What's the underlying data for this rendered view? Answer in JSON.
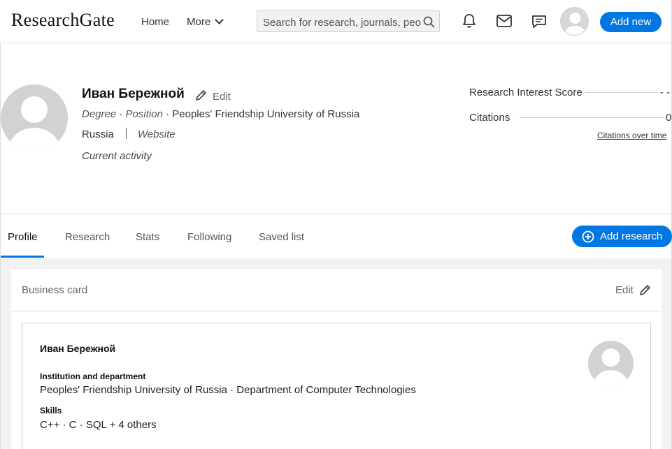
{
  "brand": {
    "logo": "ResearchGate"
  },
  "nav": {
    "home": "Home",
    "more": "More"
  },
  "search": {
    "placeholder": "Search for research, journals, people",
    "value": ""
  },
  "header": {
    "add_new": "Add new"
  },
  "profile": {
    "name": "Иван Бережной",
    "edit_label": "Edit",
    "degree": "Degree",
    "position": "Position",
    "institution": "Peoples' Friendship University of Russia",
    "dot": "·",
    "country": "Russia",
    "website": "Website",
    "current_activity": "Current activity"
  },
  "stats": {
    "ris_label": "Research Interest Score",
    "ris_value": "- -",
    "citations_label": "Citations",
    "citations_value": "0",
    "citations_over_time": "Citations over time"
  },
  "tabs": [
    {
      "label": "Profile",
      "active": true
    },
    {
      "label": "Research",
      "active": false
    },
    {
      "label": "Stats",
      "active": false
    },
    {
      "label": "Following",
      "active": false
    },
    {
      "label": "Saved list",
      "active": false
    }
  ],
  "add_research": "Add research",
  "business_card": {
    "title": "Business card",
    "edit_label": "Edit",
    "name": "Иван Бережной",
    "institution_heading": "Institution and department",
    "institution_value": "Peoples' Friendship University of Russia · Department of Computer Technologies",
    "skills_heading": "Skills",
    "skills_value": "C++ · C · SQL + 4 others"
  },
  "colors": {
    "accent": "#0077e2",
    "border": "#dddddd",
    "panel": "#f2f2f2"
  }
}
